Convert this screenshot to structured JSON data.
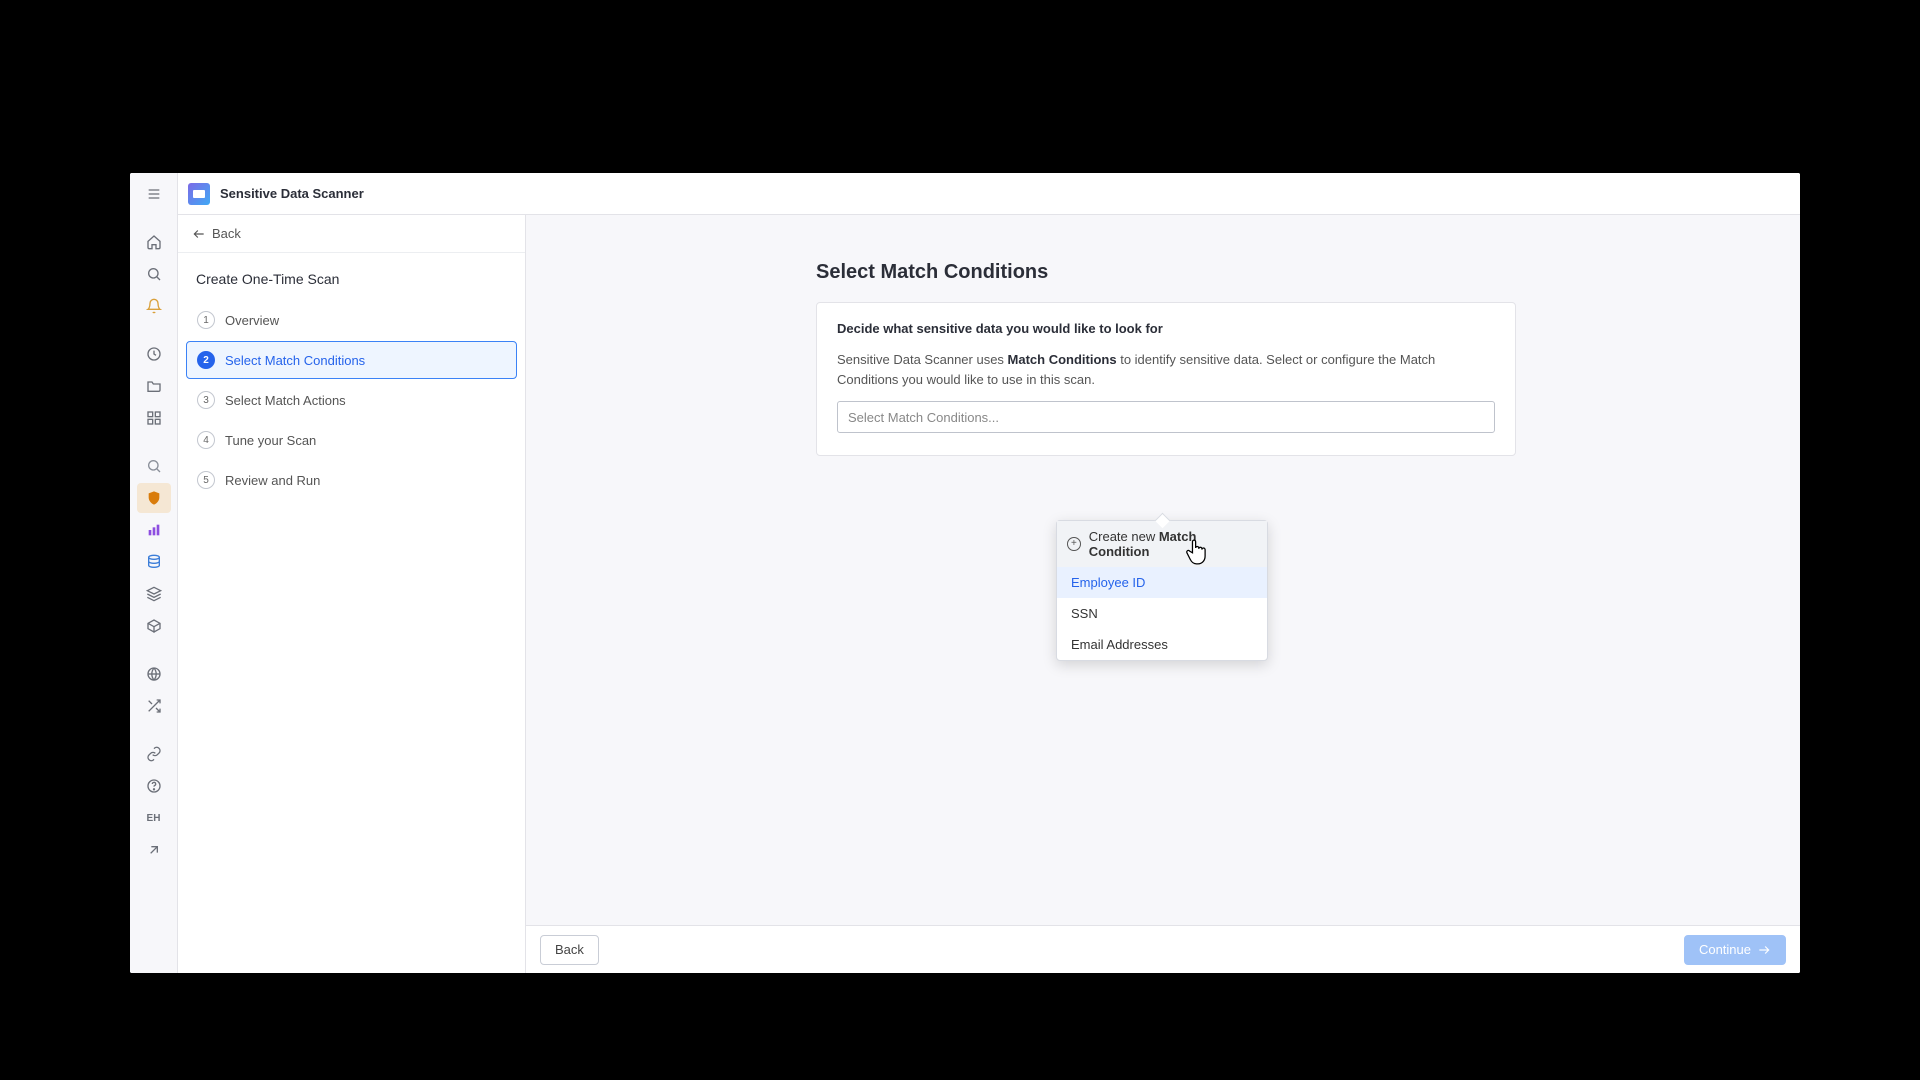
{
  "header": {
    "title": "Sensitive Data Scanner"
  },
  "back": {
    "label": "Back"
  },
  "panel": {
    "title": "Create One-Time Scan"
  },
  "steps": [
    {
      "num": "1",
      "label": "Overview"
    },
    {
      "num": "2",
      "label": "Select Match Conditions"
    },
    {
      "num": "3",
      "label": "Select Match Actions"
    },
    {
      "num": "4",
      "label": "Tune your Scan"
    },
    {
      "num": "5",
      "label": "Review and Run"
    }
  ],
  "main": {
    "heading": "Select Match Conditions",
    "subtitle": "Decide what sensitive data you would like to look for",
    "desc_pre": "Sensitive Data Scanner uses ",
    "desc_bold": "Match Conditions",
    "desc_post": " to identify sensitive data. Select or configure the Match Conditions you would like to use in this scan.",
    "placeholder": "Select Match Conditions..."
  },
  "popover": {
    "create_pre": "Create new ",
    "create_bold": "Match Condition",
    "options": [
      "Employee ID",
      "SSN",
      "Email Addresses"
    ]
  },
  "footer": {
    "back": "Back",
    "continue": "Continue"
  },
  "rail_text": "EH"
}
